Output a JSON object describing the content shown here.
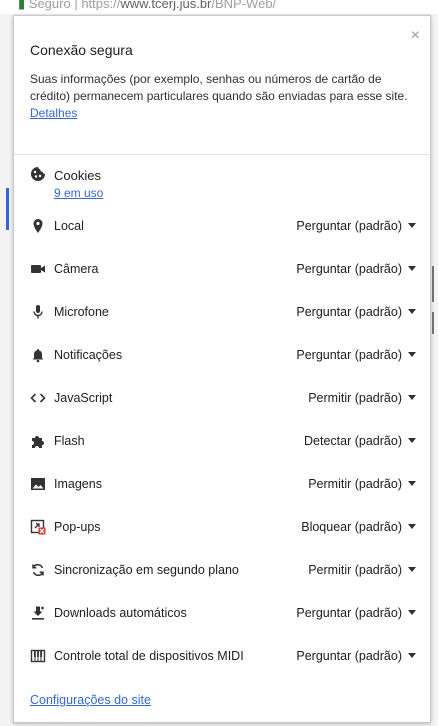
{
  "browser": {
    "security_label": "Seguro",
    "url_prefix": "https://",
    "url_host": "www.tcerj.jus.br",
    "url_path": "/BNP-Web/"
  },
  "popup": {
    "title": "Conexão segura",
    "description": "Suas informações (por exemplo, senhas ou números de cartão de crédito) permanecem particulares quando são enviadas para esse site.",
    "details_link": "Detalhes",
    "close_icon": "×",
    "cookies": {
      "label": "Cookies",
      "sub_link": "9 em uso"
    },
    "permissions": [
      {
        "label": "Local",
        "value": "Perguntar (padrão)",
        "icon": "location-pin-icon"
      },
      {
        "label": "Câmera",
        "value": "Perguntar (padrão)",
        "icon": "camera-icon"
      },
      {
        "label": "Microfone",
        "value": "Perguntar (padrão)",
        "icon": "microphone-icon"
      },
      {
        "label": "Notificações",
        "value": "Perguntar (padrão)",
        "icon": "bell-icon"
      },
      {
        "label": "JavaScript",
        "value": "Permitir (padrão)",
        "icon": "code-icon"
      },
      {
        "label": "Flash",
        "value": "Detectar (padrão)",
        "icon": "puzzle-icon"
      },
      {
        "label": "Imagens",
        "value": "Permitir (padrão)",
        "icon": "image-icon"
      },
      {
        "label": "Pop-ups",
        "value": "Bloquear (padrão)",
        "icon": "popup-blocked-icon"
      },
      {
        "label": "Sincronização em segundo plano",
        "value": "Permitir (padrão)",
        "icon": "sync-icon"
      },
      {
        "label": "Downloads automáticos",
        "value": "Perguntar (padrão)",
        "icon": "download-icon"
      },
      {
        "label": "Controle total de dispositivos MIDI",
        "value": "Perguntar (padrão)",
        "icon": "midi-piano-icon"
      }
    ],
    "site_settings_link": "Configurações do site"
  }
}
